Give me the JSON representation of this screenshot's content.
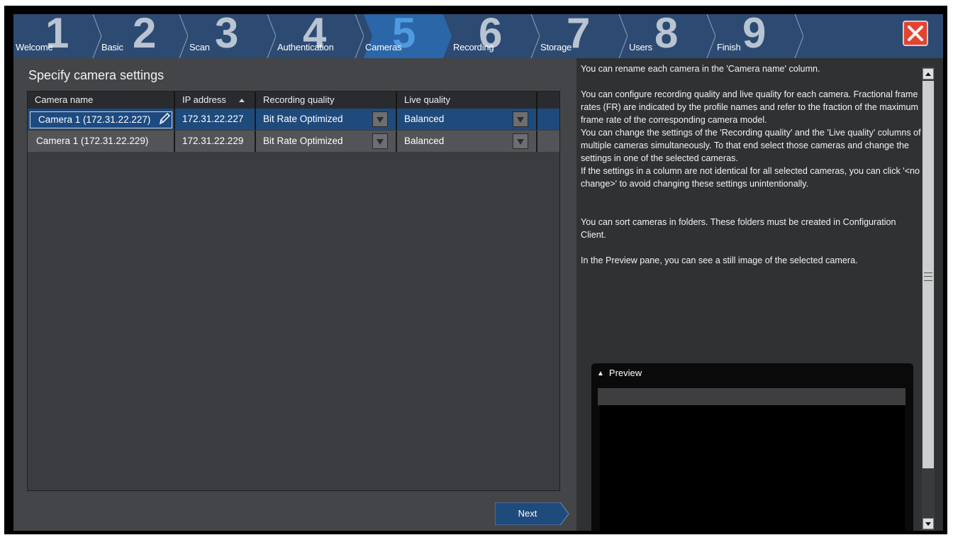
{
  "window": {
    "close_label": "Close"
  },
  "steps": [
    {
      "num": "1",
      "label": "Welcome"
    },
    {
      "num": "2",
      "label": "Basic"
    },
    {
      "num": "3",
      "label": "Scan"
    },
    {
      "num": "4",
      "label": "Authentication"
    },
    {
      "num": "5",
      "label": "Cameras",
      "active": true
    },
    {
      "num": "6",
      "label": "Recording"
    },
    {
      "num": "7",
      "label": "Storage"
    },
    {
      "num": "8",
      "label": "Users"
    },
    {
      "num": "9",
      "label": "Finish"
    }
  ],
  "main": {
    "title": "Specify camera settings",
    "table": {
      "columns": [
        "Camera name",
        "IP address",
        "Recording quality",
        "Live quality"
      ],
      "sorted_column": "IP address",
      "rows": [
        {
          "name": "Camera 1 (172.31.22.227)",
          "ip": "172.31.22.227",
          "recording": "Bit Rate Optimized",
          "live": "Balanced",
          "selected": true,
          "editing": true
        },
        {
          "name": "Camera 1 (172.31.22.229)",
          "ip": "172.31.22.229",
          "recording": "Bit Rate Optimized",
          "live": "Balanced",
          "selected": false
        }
      ]
    },
    "next_label": "Next"
  },
  "help": {
    "paragraphs": [
      "You can rename each camera in the 'Camera name' column.",
      "You can configure recording quality and live quality for each camera. Fractional frame rates (FR) are indicated by the profile names and refer to the fraction of the maximum frame rate of the corresponding camera model.",
      "You can change the settings of the 'Recording quality' and the 'Live quality' columns of multiple cameras simultaneously. To that end select those cameras and change the settings in one of the selected cameras.",
      "If the settings in a column are not identical for all selected cameras, you can click '<no change>' to avoid changing these settings unintentionally.",
      "You can sort cameras in folders. These folders must be created in Configuration Client.",
      "In the Preview pane, you can see a still image of the selected camera."
    ],
    "preview_label": "Preview"
  },
  "colors": {
    "accent": "#1f4a7c",
    "step_bar": "#2d4a72",
    "close": "#e6432f"
  }
}
